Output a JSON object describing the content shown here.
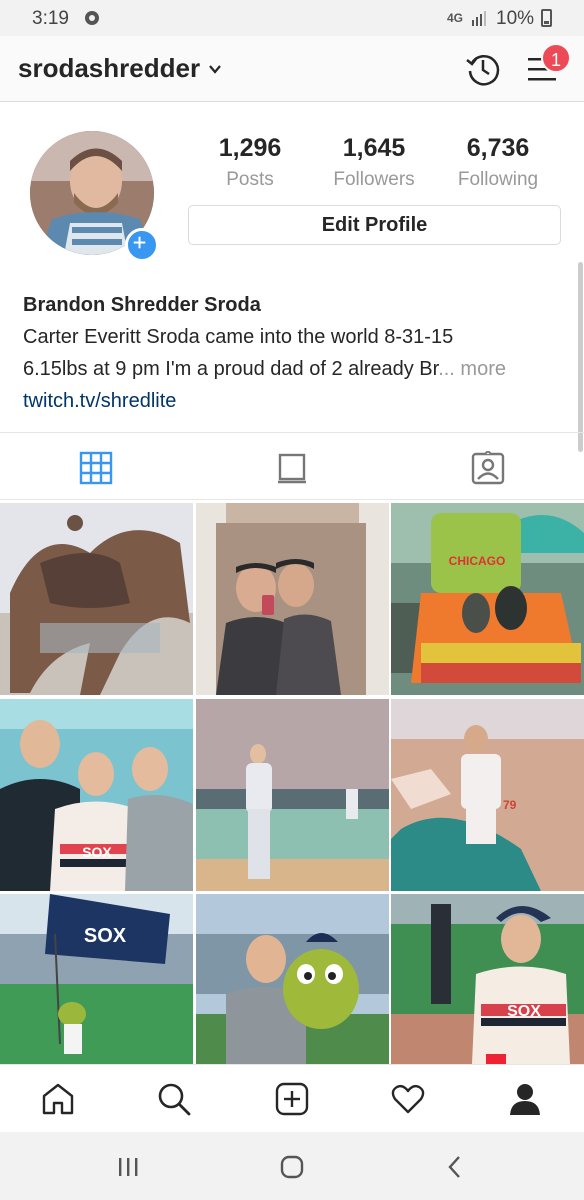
{
  "status_bar": {
    "time": "3:19",
    "network": "4G",
    "battery": "10%"
  },
  "header": {
    "username": "srodashredder",
    "notification_count": "1"
  },
  "profile": {
    "stats": [
      {
        "value": "1,296",
        "label": "Posts"
      },
      {
        "value": "1,645",
        "label": "Followers"
      },
      {
        "value": "6,736",
        "label": "Following"
      }
    ],
    "edit_button": "Edit Profile",
    "name": "Brandon Shredder Sroda",
    "bio_line1": "Carter Everitt  Sroda  came into the world 8-31-15",
    "bio_line2": "6.15lbs at 9 pm I'm a proud dad of 2  already Br",
    "bio_more": "... more",
    "link": "twitch.tv/shredlite"
  },
  "tabs": [
    {
      "icon": "grid-icon",
      "active": true
    },
    {
      "icon": "feed-icon",
      "active": false
    },
    {
      "icon": "tagged-icon",
      "active": false
    }
  ],
  "grid_text": {
    "sign": "CHICAGO",
    "jersey": "SOX",
    "number": "79"
  },
  "bottom_nav": [
    "home-icon",
    "search-icon",
    "add-post-icon",
    "activity-icon",
    "profile-icon"
  ],
  "colors": {
    "accent": "#3897f0",
    "badge": "#ed4956",
    "link": "#003569",
    "muted": "#999999"
  }
}
